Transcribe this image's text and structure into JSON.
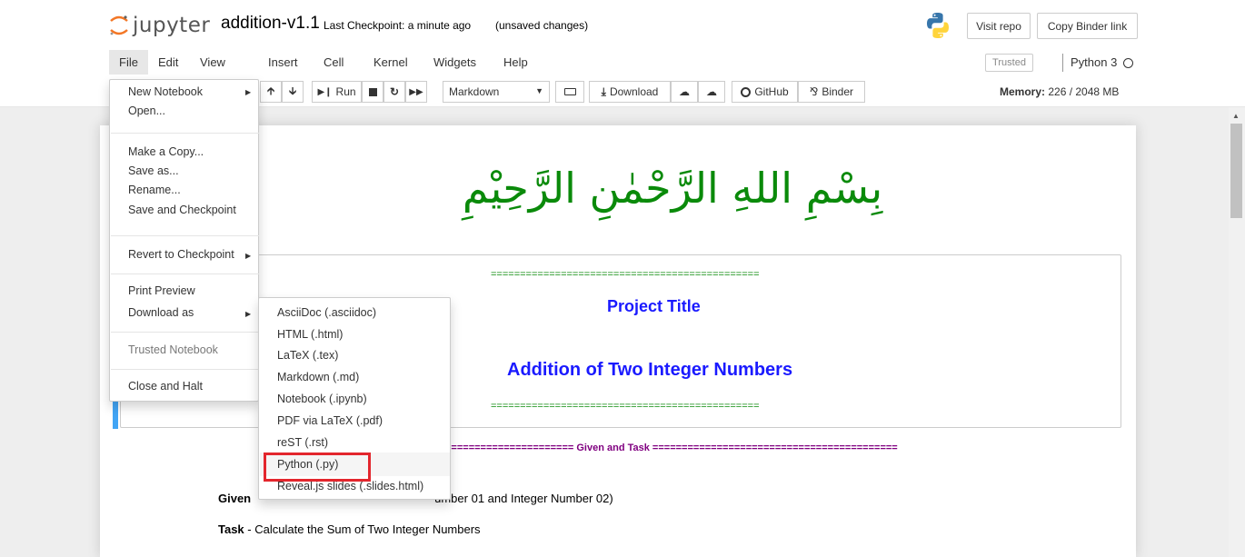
{
  "header": {
    "logo_text": "jupyter",
    "notebook_name": "addition-v1.1",
    "checkpoint": "Last Checkpoint: a minute ago",
    "autosave": "(unsaved changes)",
    "visit_repo": "Visit repo",
    "copy_binder_link": "Copy Binder link"
  },
  "menubar": {
    "items": [
      "File",
      "Edit",
      "View",
      "Insert",
      "Cell",
      "Kernel",
      "Widgets",
      "Help"
    ],
    "trusted": "Trusted",
    "kernel": "Python 3"
  },
  "toolbar": {
    "run": "Run",
    "cell_type": "Markdown",
    "download": "Download",
    "github": "GitHub",
    "binder": "Binder",
    "memory_label": "Memory:",
    "memory_value": "226 / 2048 MB"
  },
  "file_menu": {
    "new_notebook": "New Notebook",
    "open": "Open...",
    "make_copy": "Make a Copy...",
    "save_as": "Save as...",
    "rename": "Rename...",
    "save_checkpoint": "Save and Checkpoint",
    "revert": "Revert to Checkpoint",
    "print_preview": "Print Preview",
    "download_as": "Download as",
    "trusted_notebook": "Trusted Notebook",
    "close_halt": "Close and Halt"
  },
  "download_menu": {
    "items": [
      "AsciiDoc (.asciidoc)",
      "HTML (.html)",
      "LaTeX (.tex)",
      "Markdown (.md)",
      "Notebook (.ipynb)",
      "PDF via LaTeX (.pdf)",
      "reST (.rst)",
      "Python (.py)",
      "Reveal.js slides (.slides.html)"
    ]
  },
  "content": {
    "bismillah": "بِسْمِ اللهِ الرَّحْمٰنِ الرَّحِيْمِ",
    "eqline": "==============================================",
    "project_title": "Project Title",
    "project_subtitle": "Addition of Two Integer Numbers",
    "given_task_line": "====================== Given and Task ==========================================",
    "given_label": "Given",
    "given_text": "umber 01 and Integer Number 02)",
    "task_label": "Task",
    "task_text": " - Calculate the Sum of Two Integer Numbers"
  },
  "colors": {
    "green": "#0a8a0a",
    "blue": "#1a1aff",
    "purple": "#800080",
    "cell_selected": "#42a5f5",
    "highlight_box": "#e3262d"
  }
}
